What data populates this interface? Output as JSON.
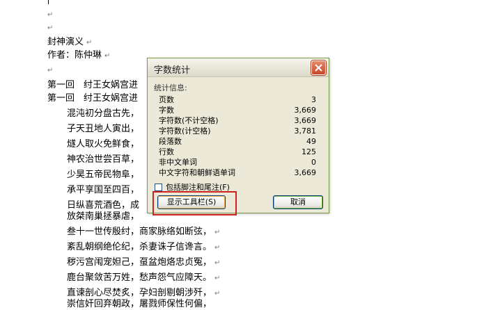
{
  "document": {
    "title_line": "封神演义",
    "author_line": "作者：陈仲琳",
    "chapter_lines": [
      "第一回　纣王女娲宫进",
      "第一回　纣王女娲宫进"
    ],
    "poem_lines": [
      "混沌初分盘古先，",
      "子天丑地人寅出，",
      "燧人取火免鲜食，",
      "神农治世尝百草，",
      "少昊五帝民物阜，",
      "承平享国至四百，",
      "日纵喜荒酒色，成",
      "放桀南巢拯暴虐，",
      "叁十一世传殷纣，商家脉络如断弦，",
      "紊乱朝纲绝伦纪，杀妻诛子信谗言。",
      "秽污宫闱宠妲己，虿盆炮烙忠贞冤，",
      "鹿台聚敛苦万姓，愁声怨气应障天。",
      "直谏剖心尽焚炙，孕妇剖剔朝涉歼，",
      "崇信奸回弃朝政，屠戮师保性何偏，"
    ],
    "paragraph_mark": "↵"
  },
  "dialog": {
    "title": "字数统计",
    "group_label": "统计信息:",
    "stats": [
      {
        "label": "页数",
        "value": "3"
      },
      {
        "label": "字数",
        "value": "3,669"
      },
      {
        "label": "字符数(不计空格)",
        "value": "3,669"
      },
      {
        "label": "字符数(计空格)",
        "value": "3,781"
      },
      {
        "label": "段落数",
        "value": "49"
      },
      {
        "label": "行数",
        "value": "125"
      },
      {
        "label": "非中文单词",
        "value": "0"
      },
      {
        "label": "中文字符和朝鲜语单词",
        "value": "3,669"
      }
    ],
    "checkbox_label": "包括脚注和尾注(F)",
    "show_toolbar_button": "显示工具栏(S)",
    "cancel_button": "取消"
  }
}
